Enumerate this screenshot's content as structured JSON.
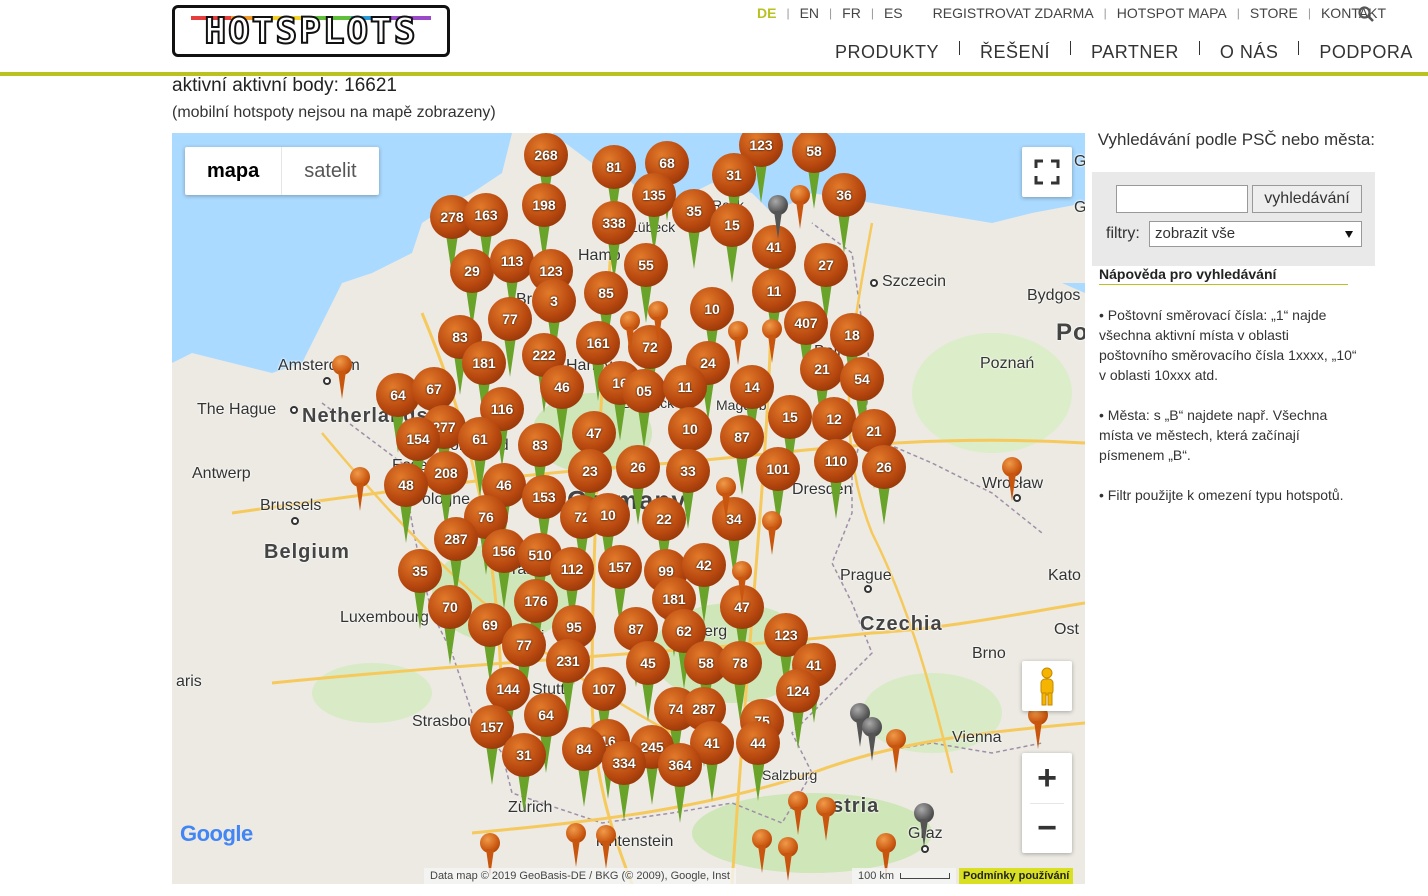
{
  "header": {
    "logo_text": "HOTSPLOTS",
    "languages": [
      {
        "label": "DE",
        "active": true
      },
      {
        "label": "EN",
        "active": false
      },
      {
        "label": "FR",
        "active": false
      },
      {
        "label": "ES",
        "active": false
      }
    ],
    "top_links": [
      "REGISTROVAT ZDARMA",
      "HOTSPOT MAPA",
      "STORE",
      "KONTAKT"
    ],
    "main_nav": [
      "PRODUKTY",
      "ŘEŠENÍ",
      "PARTNER",
      "O NÁS",
      "PODPORA"
    ],
    "accent_color": "#b9c221"
  },
  "page": {
    "title": "aktivní aktivní body: 16621",
    "subtitle": "(mobilní hotspoty nejsou na mapě zobrazeny)"
  },
  "map": {
    "type_buttons": [
      "mapa",
      "satelit"
    ],
    "zoom_in": "+",
    "zoom_out": "−",
    "google": "Google",
    "attribution": "Data map © 2019 GeoBasis-DE / BKG (© 2009), Google, Inst",
    "scale": "100 km",
    "terms": "Podmínky používání",
    "labels": {
      "amsterdam": "Amsterdam",
      "hague": "The Hague",
      "netherlands": "Netherlands",
      "antwerp": "Antwerp",
      "brussels": "Brussels",
      "belgium": "Belgium",
      "luxembourg": "Luxembourg",
      "paris": "aris",
      "strasbourg": "Strasbour",
      "zurich": "Zürich",
      "liechtenstein": "ientenstein",
      "germany": "Germany",
      "hamburg": "Hamb",
      "lubeck": "Lübeck",
      "rostock": "Rock",
      "bremen": "Bre",
      "hanover": "Hanover",
      "brunswick": "Bunwick",
      "magdeburg": "Magdeb",
      "berlin": "Beli",
      "szczecin": "Szczecin",
      "bydgoszcz": "Bydgos",
      "poznan": "Poznań",
      "po": "Po",
      "wroclaw": "Wrocław",
      "dresden": "Dresden",
      "prague": "Prague",
      "czechia": "Czechia",
      "brno": "Brno",
      "kato": "Kato",
      "ost": "Ost",
      "vienna": "Vienna",
      "salzburg": "Salzburg",
      "austria": "stria",
      "graz": "Graz",
      "essen": "Esse",
      "cologne": "ologne",
      "dortmund": "ortmund",
      "frankfurt": "rankfu",
      "stuttgart": "Stutt",
      "mannheim": "nnhei",
      "nuremberg": "renberg",
      "munich": "Mu",
      "g1": "G",
      "g2": "G"
    },
    "markers": [
      "268",
      "81",
      "68",
      "123",
      "58",
      "31",
      "135",
      "36",
      "278",
      "163",
      "198",
      "35",
      "15",
      "338",
      "41",
      "27",
      "29",
      "113",
      "123",
      "55",
      "11",
      "3",
      "85",
      "77",
      "10",
      "407",
      "18",
      "83",
      "161",
      "72",
      "222",
      "24",
      "181",
      "21",
      "54",
      "64",
      "67",
      "16",
      "46",
      "05",
      "11",
      "14",
      "277",
      "116",
      "10",
      "47",
      "87",
      "15",
      "12",
      "154",
      "61",
      "83",
      "21",
      "208",
      "23",
      "26",
      "33",
      "110",
      "26",
      "48",
      "46",
      "153",
      "101",
      "76",
      "72",
      "10",
      "22",
      "34",
      "287",
      "156",
      "510",
      "112",
      "157",
      "99",
      "42",
      "35",
      "181",
      "70",
      "176",
      "47",
      "69",
      "95",
      "87",
      "62",
      "123",
      "77",
      "231",
      "45",
      "58",
      "78",
      "41",
      "144",
      "107",
      "124",
      "74",
      "287",
      "75",
      "64",
      "157",
      "16",
      "245",
      "41",
      "44",
      "84",
      "334",
      "364",
      "31"
    ]
  },
  "sidebar": {
    "search_title": "Vyhledávání podle PSČ nebo města:",
    "search_input_value": "",
    "search_button": "vyhledávání",
    "filter_label": "filtry:",
    "filter_value": "zobrazit vše",
    "help_title": "Nápověda pro vyhledávání",
    "help_items": [
      "• Poštovní směrovací čísla: „1“ najde všechna aktivní místa v oblasti poštovního směrovacího čísla 1xxxx, „10“ v oblasti 10xxx atd.",
      "• Města: s „B“ najdete např. Všechna místa ve městech, která začínají písmenem „B“.",
      "• Filtr použijte k omezení typu hotspotů."
    ]
  }
}
